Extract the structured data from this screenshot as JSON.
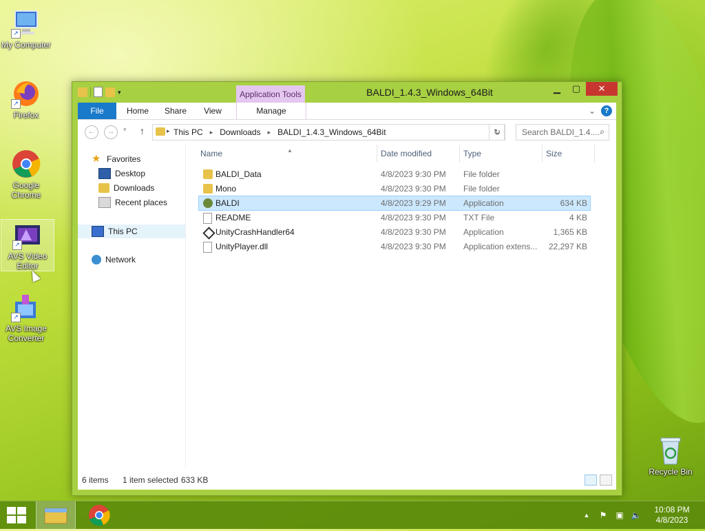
{
  "desktop": {
    "icons": [
      {
        "label": "My Computer"
      },
      {
        "label": "Firefox"
      },
      {
        "label": "Google Chrome"
      },
      {
        "label": "AVS Video Editor"
      },
      {
        "label": "AVS Image Converter"
      },
      {
        "label": "Recycle Bin"
      }
    ]
  },
  "window": {
    "title": "BALDI_1.4.3_Windows_64Bit",
    "context_tab_group": "Application Tools",
    "ribbon_tabs": [
      "File",
      "Home",
      "Share",
      "View",
      "Manage"
    ],
    "address": {
      "crumbs": [
        "This PC",
        "Downloads",
        "BALDI_1.4.3_Windows_64Bit"
      ],
      "search_placeholder": "Search BALDI_1.4...."
    },
    "nav_pane": {
      "favorites": "Favorites",
      "favorites_items": [
        "Desktop",
        "Downloads",
        "Recent places"
      ],
      "this_pc": "This PC",
      "network": "Network"
    },
    "columns": {
      "name": "Name",
      "date": "Date modified",
      "type": "Type",
      "size": "Size"
    },
    "files": [
      {
        "name": "BALDI_Data",
        "date": "4/8/2023 9:30 PM",
        "type": "File folder",
        "size": "",
        "icon": "folder-icon"
      },
      {
        "name": "Mono",
        "date": "4/8/2023 9:30 PM",
        "type": "File folder",
        "size": "",
        "icon": "folder-icon"
      },
      {
        "name": "BALDI",
        "date": "4/8/2023 9:29 PM",
        "type": "Application",
        "size": "634 KB",
        "icon": "app-icon",
        "selected": true
      },
      {
        "name": "README",
        "date": "4/8/2023 9:30 PM",
        "type": "TXT File",
        "size": "4 KB",
        "icon": "text-file-icon"
      },
      {
        "name": "UnityCrashHandler64",
        "date": "4/8/2023 9:30 PM",
        "type": "Application",
        "size": "1,365 KB",
        "icon": "unity-icon"
      },
      {
        "name": "UnityPlayer.dll",
        "date": "4/8/2023 9:30 PM",
        "type": "Application extens...",
        "size": "22,297 KB",
        "icon": "dll-icon"
      }
    ],
    "status": {
      "items": "6 items",
      "selected": "1 item selected",
      "size": "633 KB"
    }
  },
  "taskbar": {
    "time": "10:08 PM",
    "date": "4/8/2023"
  },
  "colors": {
    "accent": "#1979ca",
    "window_frame": "#a7d042",
    "selection": "#cce8ff",
    "context_tab": "#e4c7ef",
    "close": "#c7372f"
  }
}
